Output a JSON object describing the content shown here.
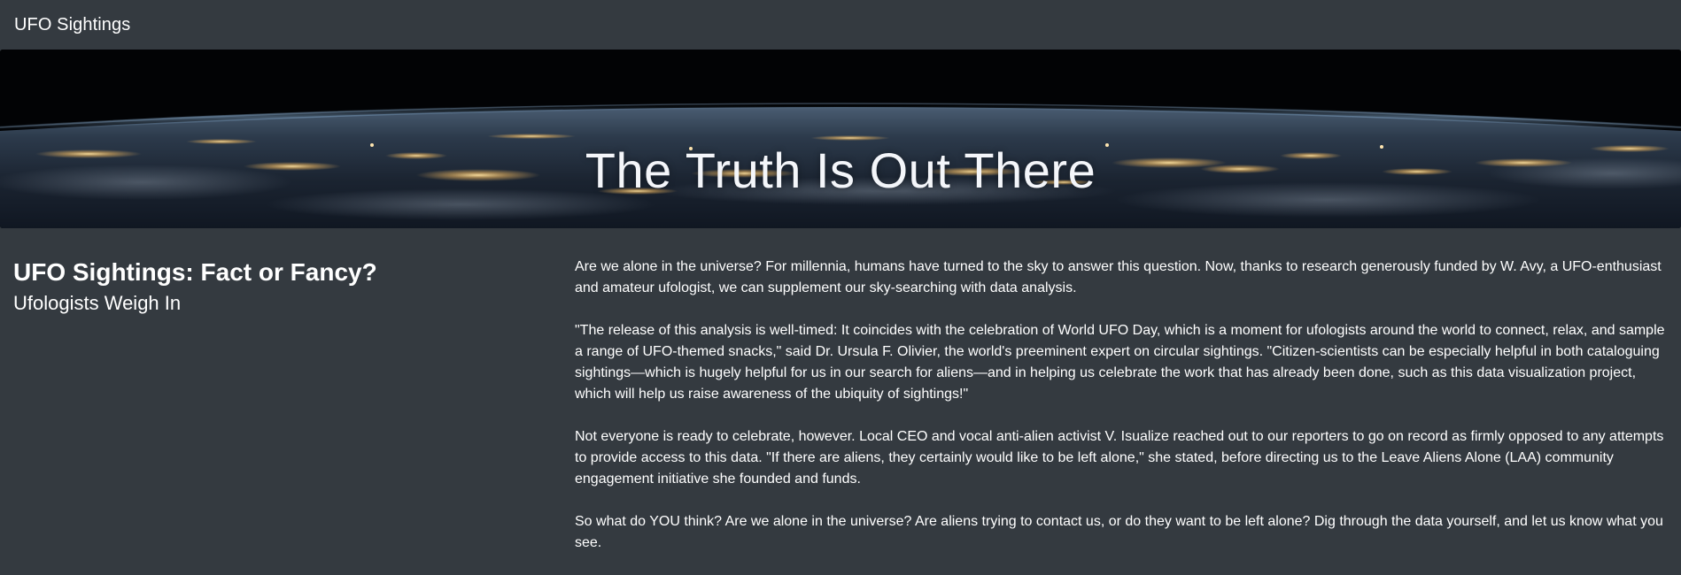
{
  "navbar": {
    "brand": "UFO Sightings"
  },
  "hero": {
    "title": "The Truth Is Out There"
  },
  "left_column": {
    "headline": "UFO Sightings: Fact or Fancy?",
    "subheadline": "Ufologists Weigh In"
  },
  "article": {
    "paragraphs": [
      "Are we alone in the universe? For millennia, humans have turned to the sky to answer this question. Now, thanks to research generously funded by W. Avy, a UFO-enthusiast and amateur ufologist, we can supplement our sky-searching with data analysis.",
      "\"The release of this analysis is well-timed: It coincides with the celebration of World UFO Day, which is a moment for ufologists around the world to connect, relax, and sample a range of UFO-themed snacks,\" said Dr. Ursula F. Olivier, the world's preeminent expert on circular sightings. \"Citizen-scientists can be especially helpful in both cataloguing sightings—which is hugely helpful for us in our search for aliens—and in helping us celebrate the work that has already been done, such as this data visualization project, which will help us raise awareness of the ubiquity of sightings!\"",
      "Not everyone is ready to celebrate, however. Local CEO and vocal anti-alien activist V. Isualize reached out to our reporters to go on record as firmly opposed to any attempts to provide access to this data. \"If there are aliens, they certainly would like to be left alone,\" she stated, before directing us to the Leave Aliens Alone (LAA) community engagement initiative she founded and funds.",
      "So what do YOU think? Are we alone in the universe? Are aliens trying to contact us, or do they want to be left alone? Dig through the data yourself, and let us know what you see."
    ]
  },
  "colors": {
    "page_background": "#343a40",
    "text": "#ffffff",
    "hero_background": "#020305",
    "city_lights": "#ffd27a"
  }
}
